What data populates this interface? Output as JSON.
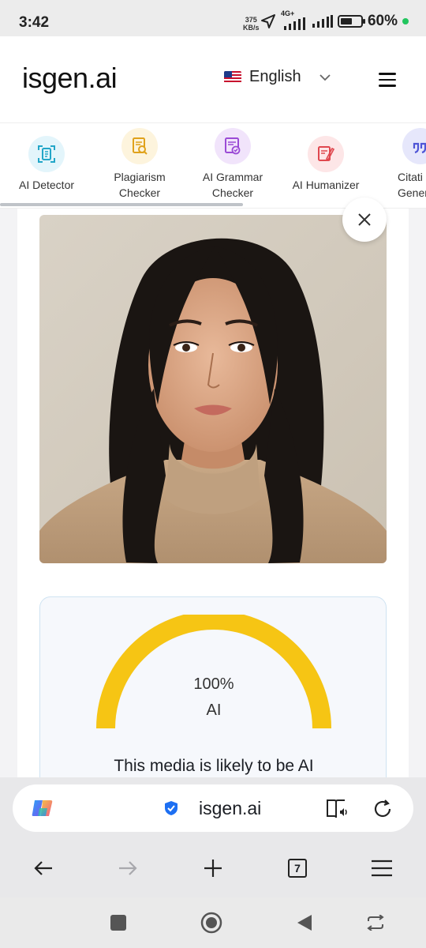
{
  "status_bar": {
    "time": "3:42",
    "net_speed_value": "375",
    "net_speed_unit": "KB/s",
    "network_type": "4G+",
    "battery_percent": "60%",
    "battery_level": 0.6
  },
  "header": {
    "logo": "isgen.ai",
    "language": "English",
    "flag_icon": "us-flag-icon"
  },
  "tools": [
    {
      "label_line1": "AI Detector",
      "label_line2": "",
      "icon": "ai-detector-icon",
      "color": "#22a6c8",
      "bg": "#e3f5fb"
    },
    {
      "label_line1": "Plagiarism",
      "label_line2": "Checker",
      "icon": "plagiarism-icon",
      "color": "#e0a21b",
      "bg": "#fdf4dd"
    },
    {
      "label_line1": "AI Grammar",
      "label_line2": "Checker",
      "icon": "grammar-icon",
      "color": "#9b4bd6",
      "bg": "#f1e4fb"
    },
    {
      "label_line1": "AI Humanizer",
      "label_line2": "",
      "icon": "humanizer-icon",
      "color": "#e0484f",
      "bg": "#fde6e7"
    },
    {
      "label_line1": "Citati",
      "label_line2": "Genera",
      "icon": "citation-icon",
      "color": "#4f55d6",
      "bg": "#e6e7fb"
    }
  ],
  "result": {
    "percent": "100%",
    "percent_value": 100,
    "label": "AI",
    "message": "This media is likely to be AI",
    "gauge_color": "#f6c514"
  },
  "browser": {
    "url": "isgen.ai",
    "tab_count": "7"
  }
}
